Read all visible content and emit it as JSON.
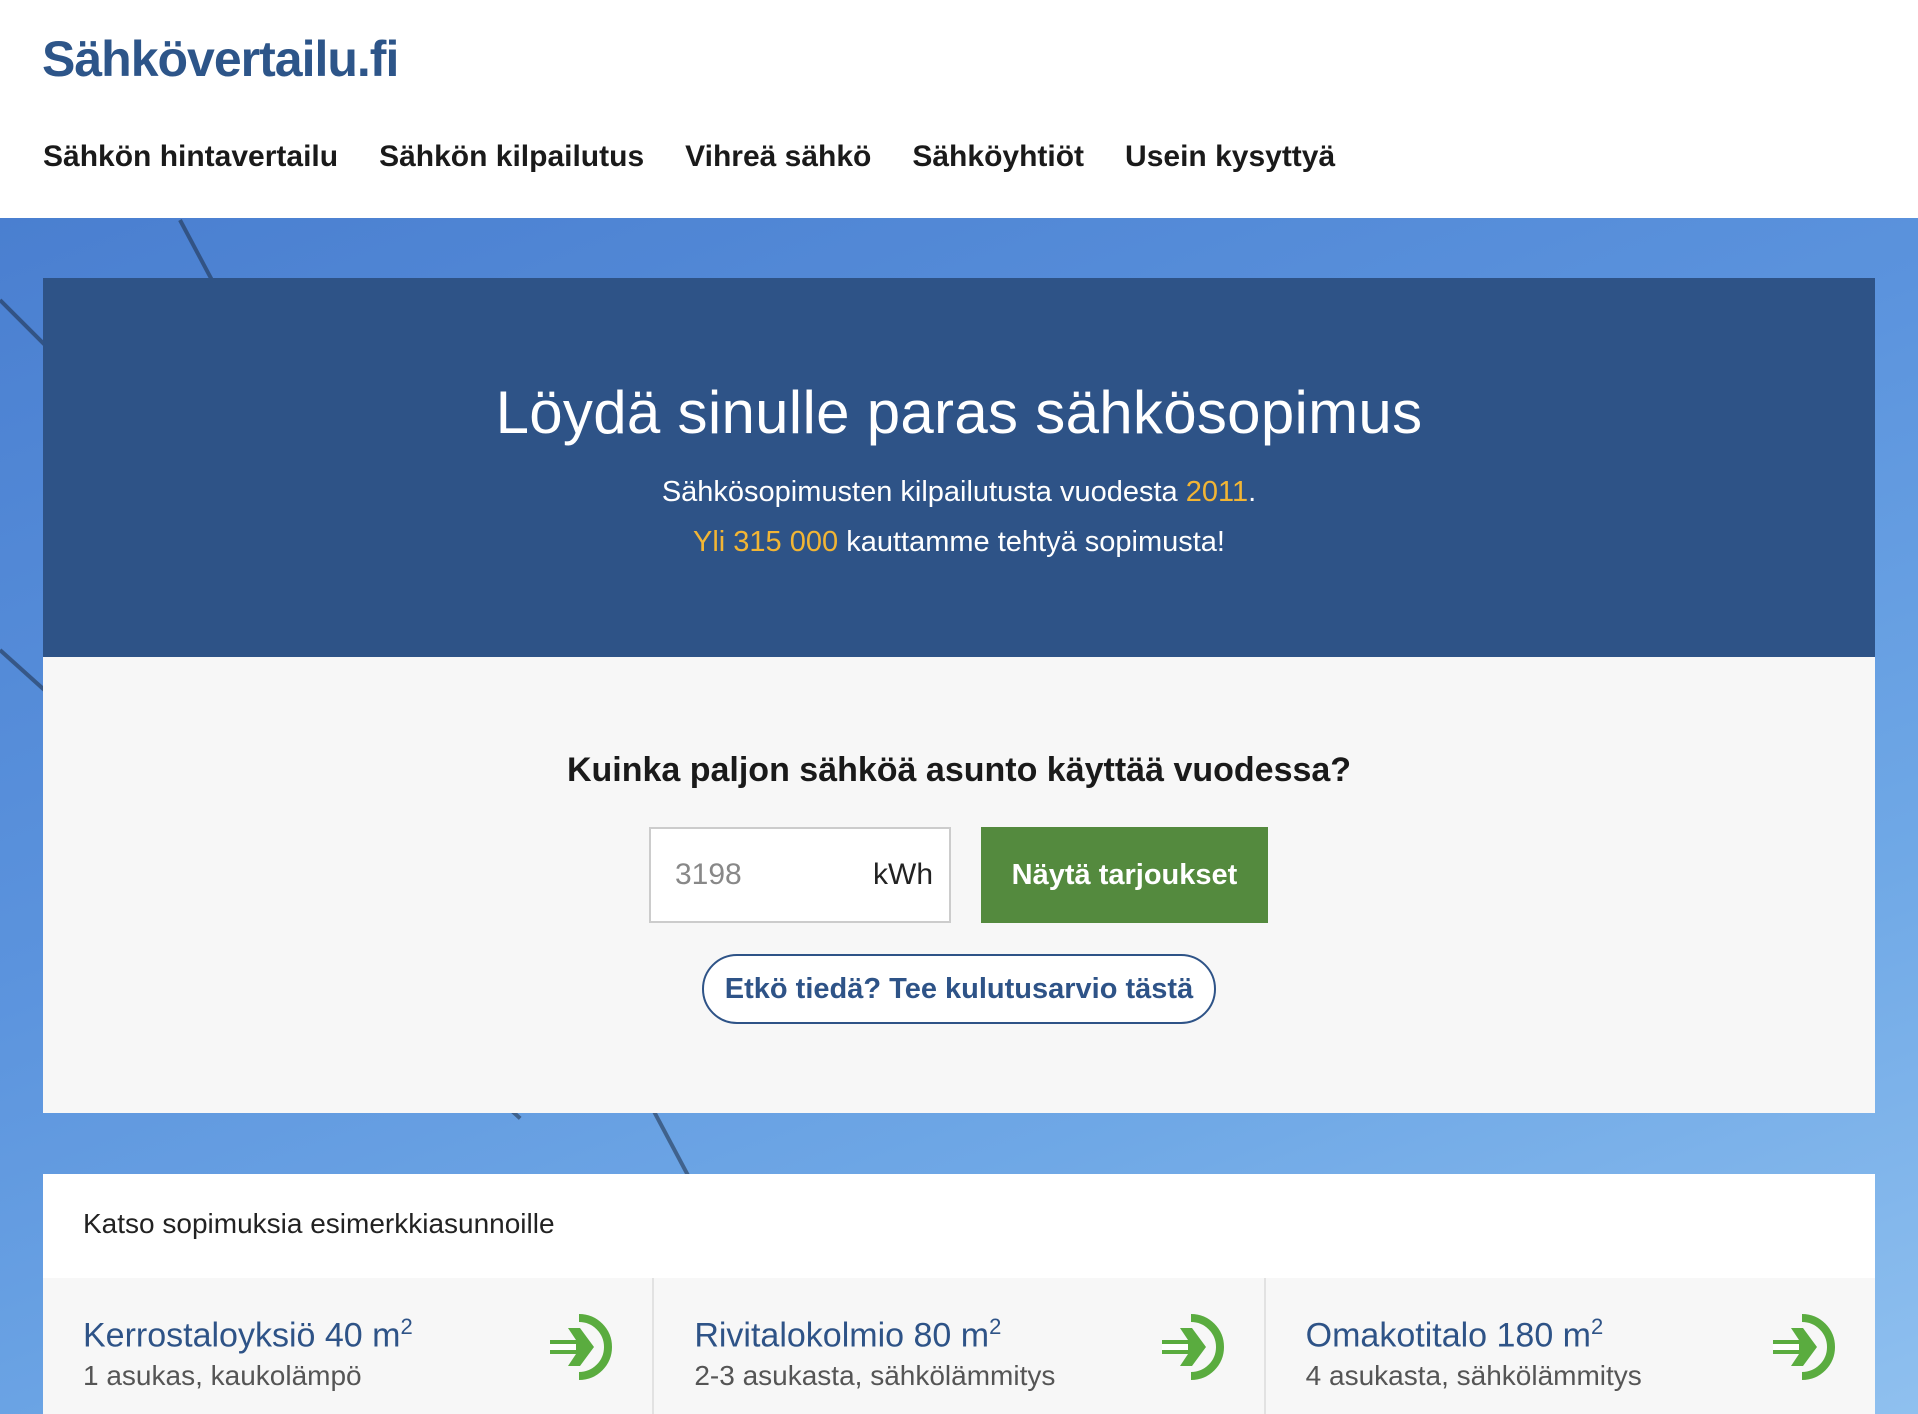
{
  "site": {
    "logo": "Sähkövertailu.fi"
  },
  "nav": [
    {
      "label": "Sähkön hintavertailu"
    },
    {
      "label": "Sähkön kilpailutus"
    },
    {
      "label": "Vihreä sähkö"
    },
    {
      "label": "Sähköyhtiöt"
    },
    {
      "label": "Usein kysyttyä"
    }
  ],
  "hero": {
    "title": "Löydä sinulle paras sähkösopimus",
    "line1_text": "Sähkösopimusten kilpailutusta vuodesta ",
    "line1_year": "2011",
    "line1_end": ".",
    "line2_highlight": "Yli 315 000",
    "line2_text": " kauttamme tehtyä sopimusta!",
    "accent_color": "#f2b534",
    "panel_color": "#2e5387"
  },
  "form": {
    "question": "Kuinka paljon sähköä asunto käyttää vuodessa?",
    "consumption_placeholder": "3198",
    "unit": "kWh",
    "submit_label": "Näytä tarjoukset",
    "estimate_label": "Etkö tiedä? Tee kulutusarvio tästä",
    "button_color": "#548a3e"
  },
  "examples": {
    "heading": "Katso sopimuksia esimerkkiasunnoille",
    "cards": [
      {
        "title": "Kerrostaloyksiö 40 m",
        "sup": "2",
        "subtitle": "1 asukas, kaukolämpö",
        "icon": "arrow-right-circle-icon"
      },
      {
        "title": "Rivitalokolmio 80 m",
        "sup": "2",
        "subtitle": "2-3 asukasta, sähkölämmitys",
        "icon": "arrow-right-circle-icon"
      },
      {
        "title": "Omakotitalo 180 m",
        "sup": "2",
        "subtitle": "4 asukasta, sähkölämmitys",
        "icon": "arrow-right-circle-icon"
      }
    ]
  }
}
